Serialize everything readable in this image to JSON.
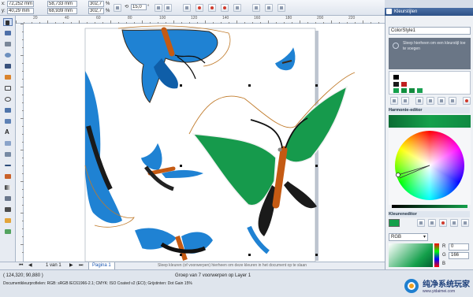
{
  "propbar": {
    "x": "72,252 mm",
    "y": "40,29 mm",
    "w": "58,733 mm",
    "h": "68,939 mm",
    "sx": "302,7",
    "sy": "302,7",
    "pct": "%",
    "rot": "15,0",
    "ruler_unit": "millimeter"
  },
  "ruler": {
    "ticks": [
      "20",
      "40",
      "60",
      "80",
      "100",
      "120",
      "140",
      "160",
      "180",
      "200",
      "220"
    ]
  },
  "pagebar": {
    "nav": "1 van 1",
    "page": "Pagina 1",
    "hint": "Sleep kleuren (of voorwerpen) hierheen om deze kleuren in het document op te slaan"
  },
  "status": {
    "coords": "( 124,320; 90,880 )",
    "selection": "Groep van 7 voorwerpen op Layer 1",
    "profile": "Documentkleurprofielen: RGB: sRGB IEC61966-2.1; CMYK: ISO Coated v2 (ECI); Grijstinten: Dot Gain 15%"
  },
  "panel": {
    "title": "Kleurstijlen",
    "style_name": "ColorStyle1",
    "drop_hint": "Sleep hierheen om een kleurstijl toe te voegen",
    "harmony": "Harmonie-editor",
    "color_editor": "Kleureneditor",
    "model": "RGB",
    "r_label": "R",
    "r_value": "0",
    "g_label": "G",
    "g_value": "166",
    "b_label": "B"
  },
  "colors": {
    "accent": "#14a04b",
    "blue": "#1a7fd1",
    "orange": "#c45a13"
  },
  "watermark": {
    "title": "纯净系统玩家",
    "url": "www.yidaimei.com"
  }
}
